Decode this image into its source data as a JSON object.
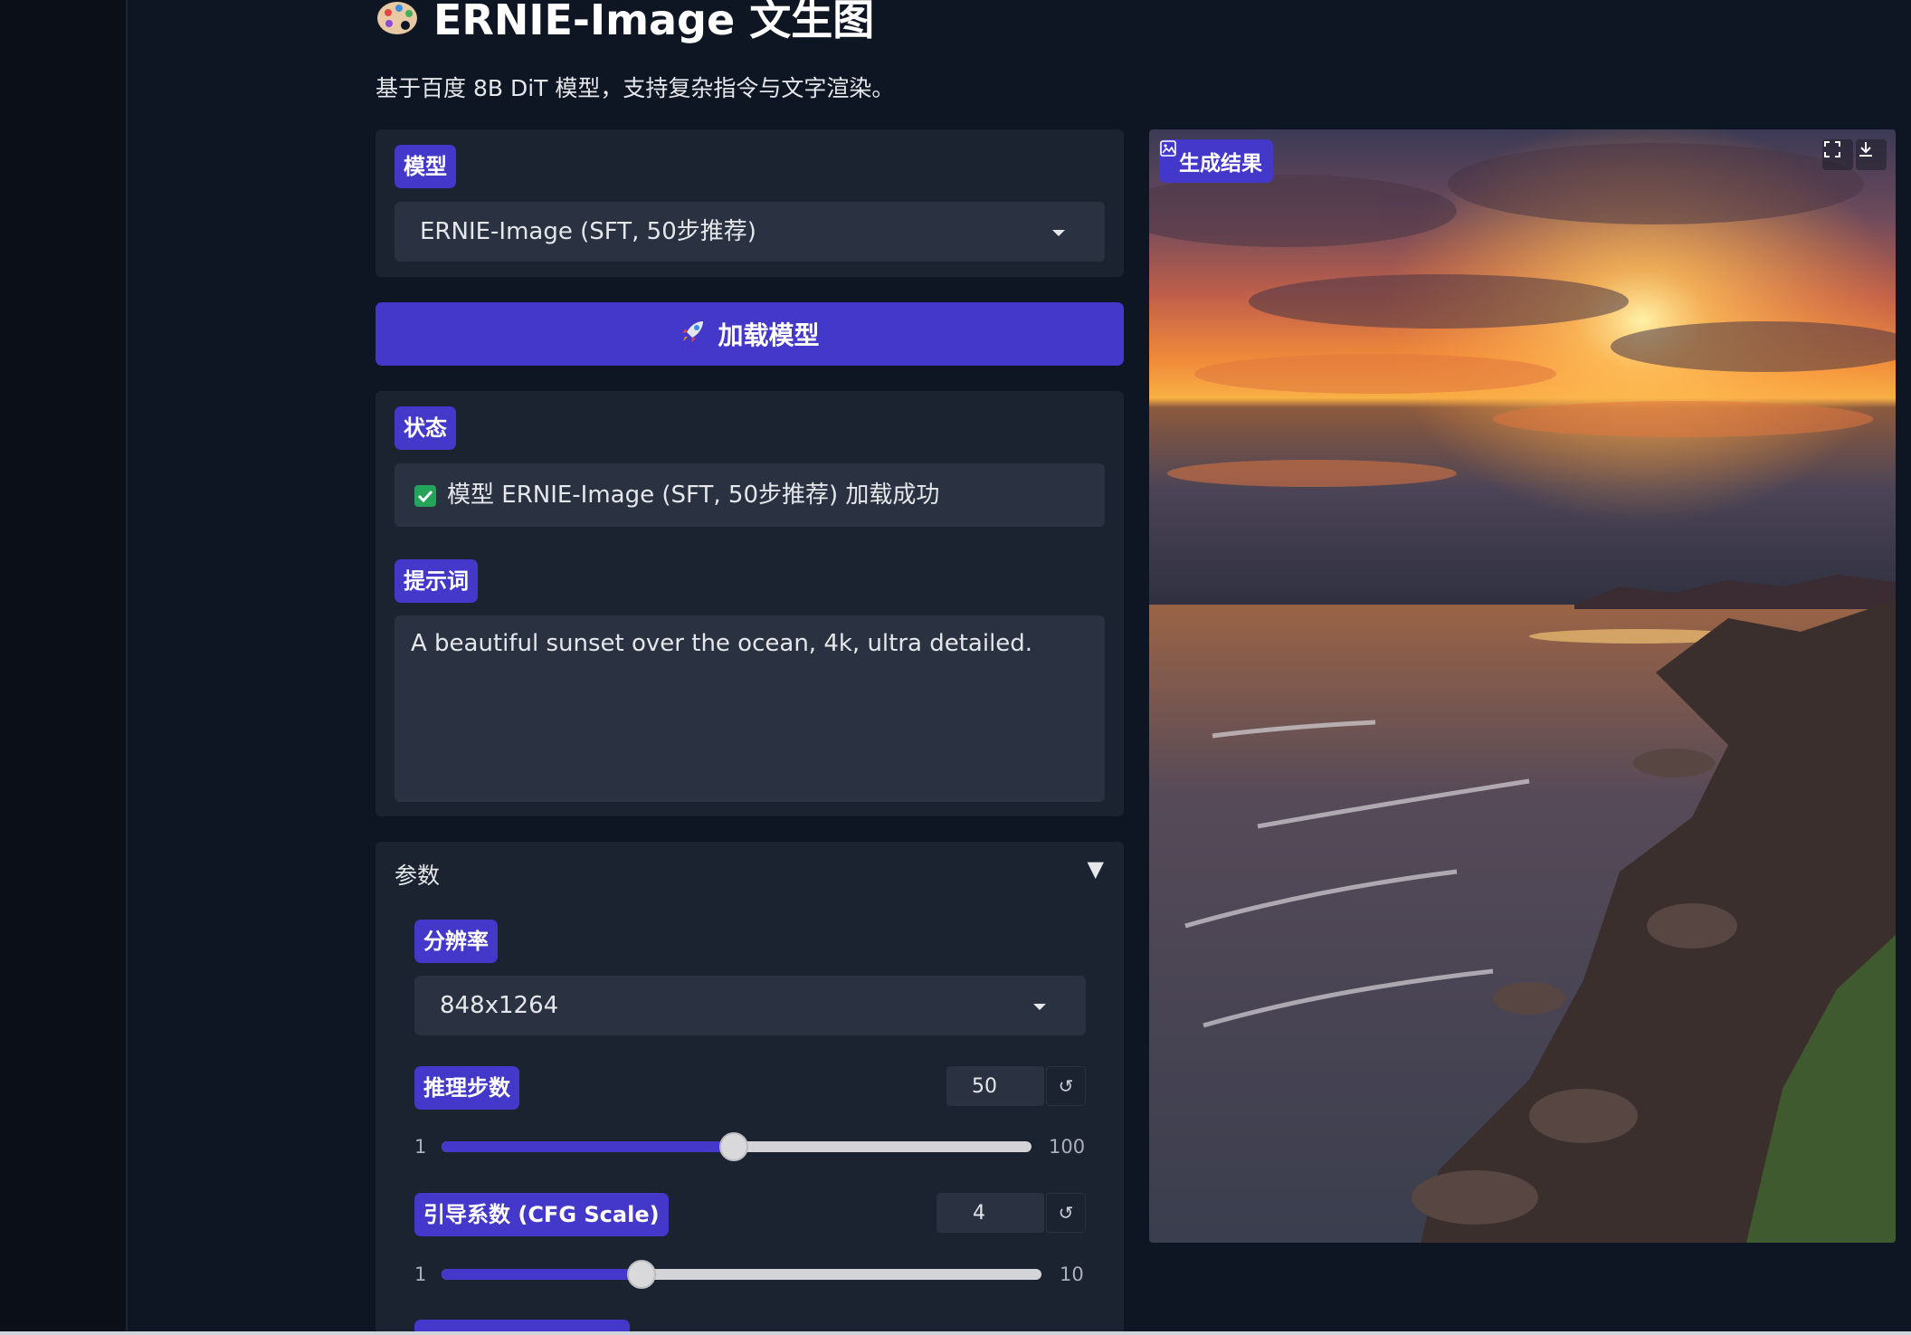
{
  "header": {
    "title": "ERNIE-Image 文生图",
    "subtitle": "基于百度 8B DiT 模型，支持复杂指令与文字渲染。"
  },
  "model": {
    "label": "模型",
    "selected": "ERNIE-Image (SFT, 50步推荐)"
  },
  "load_button": {
    "label": "加载模型"
  },
  "status": {
    "label": "状态",
    "text": "模型 ERNIE-Image (SFT, 50步推荐) 加载成功"
  },
  "prompt": {
    "label": "提示词",
    "value": "A beautiful sunset over the ocean, 4k, ultra detailed."
  },
  "params": {
    "title": "参数",
    "collapse_glyph": "▼",
    "resolution": {
      "label": "分辨率",
      "selected": "848x1264"
    },
    "steps": {
      "label": "推理步数",
      "value": "50",
      "min": "1",
      "max": "100",
      "fraction": 0.495
    },
    "cfg": {
      "label": "引导系数 (CFG Scale)",
      "value": "4",
      "min": "1",
      "max": "10",
      "fraction": 0.333
    },
    "reset_glyph": "↺"
  },
  "result": {
    "label": "生成结果"
  },
  "colors": {
    "accent": "#4338ca",
    "background": "#0f1623",
    "panel": "#1b2230",
    "field": "#2a3241",
    "success": "#22a559"
  }
}
